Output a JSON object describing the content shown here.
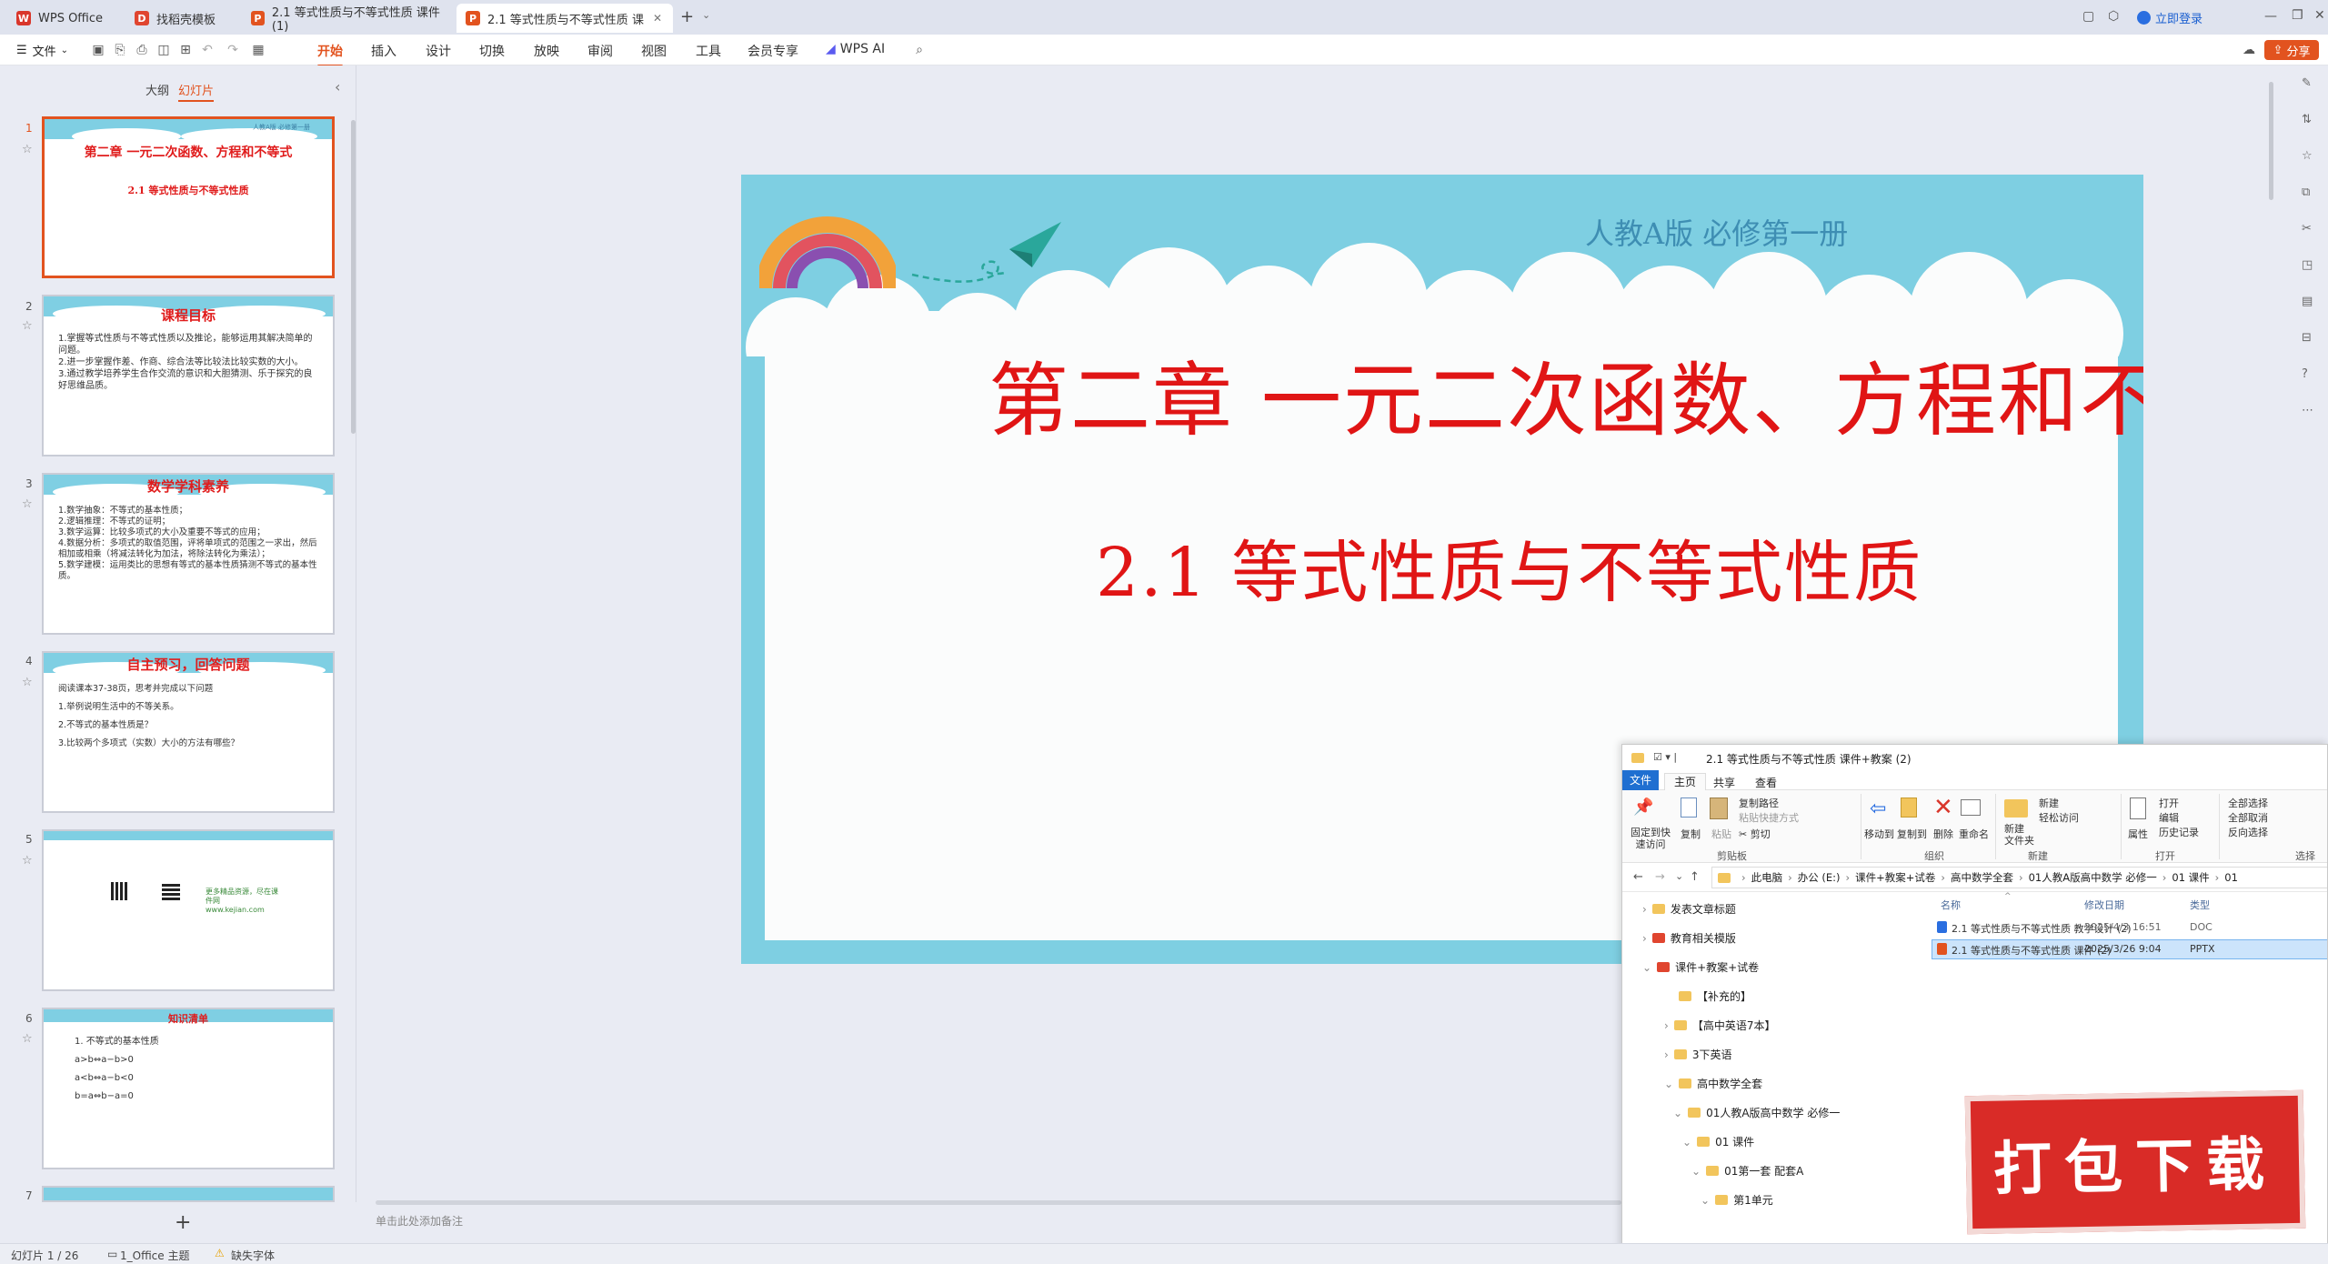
{
  "titlebar": {
    "tabs": [
      {
        "label": "WPS Office",
        "icon": "wps-logo-icon",
        "color": "#d9362b"
      },
      {
        "label": "找稻壳模板",
        "icon": "docer-icon",
        "color": "#e0452f"
      },
      {
        "label": "2.1 等式性质与不等式性质 课件 (1)",
        "icon": "ppt-icon",
        "color": "#e2531f"
      },
      {
        "label": "2.1 等式性质与不等式性质 课",
        "icon": "ppt-icon",
        "color": "#e2531f"
      }
    ],
    "login_label": "立即登录"
  },
  "menubar": {
    "file_label": "文件",
    "items": [
      "开始",
      "插入",
      "设计",
      "切换",
      "放映",
      "审阅",
      "视图",
      "工具",
      "会员专享",
      "WPS AI"
    ],
    "active": "开始",
    "share_label": "分享"
  },
  "leftpanel": {
    "tabs": [
      "大纲",
      "幻灯片"
    ],
    "active_tab": "幻灯片",
    "add_label": "+",
    "slides": [
      {
        "num": "1",
        "title": "第二章 一元二次函数、方程和不等式",
        "subtitle": "2.1 等式性质与不等式性质",
        "corner": "人教A版 必修第一册"
      },
      {
        "num": "2",
        "title": "课程目标",
        "body": "1.掌握等式性质与不等式性质以及推论，能够运用其解决简单的问题。\n2.进一步掌握作差、作商、综合法等比较法比较实数的大小。\n3.通过教学培养学生合作交流的意识和大胆猜测、乐于探究的良好思维品质。"
      },
      {
        "num": "3",
        "title": "数学学科素养",
        "body": "1.数学抽象：不等式的基本性质；\n2.逻辑推理：不等式的证明；\n3.数学运算：比较多项式的大小及重要不等式的应用；\n4.数据分析：多项式的取值范围，评将单项式的范围之一求出，然后相加或相乘（将减法转化为加法，将除法转化为乘法）；\n5.数学建模：运用类比的思想有等式的基本性质猜测不等式的基本性质。"
      },
      {
        "num": "4",
        "title": "自主预习，回答问题",
        "body": "阅读课本37-38页，思考并完成以下问题\n1.举例说明生活中的不等关系。\n2.不等式的基本性质是？\n3.比较两个多项式（实数）大小的方法有哪些？"
      },
      {
        "num": "5",
        "title": "",
        "body": "更多精品资源，尽在课件网\n www.kejian.com"
      },
      {
        "num": "6",
        "title": "知识清单",
        "body": "1. 不等式的基本性质\na>b⇔a−b>0\na<b⇔a−b<0\nb=a⇔b−a=0"
      },
      {
        "num": "7",
        "title": "",
        "body": ""
      }
    ]
  },
  "slide": {
    "edition": "人教A版 必修第一册",
    "chapter_title": "第二章  一元二次函数、方程和不等式",
    "section_title": "2.1 等式性质与不等式性质",
    "notes_placeholder": "单击此处添加备注"
  },
  "explorer": {
    "title": "2.1 等式性质与不等式性质 课件+教案 (2)",
    "ribbon_tabs": [
      "文件",
      "主页",
      "共享",
      "查看"
    ],
    "clipboard": {
      "pin": "固定到快速访问",
      "copy": "复制",
      "paste": "粘贴",
      "copy_path": "复制路径",
      "paste_shortcut": "粘贴快捷方式",
      "cut": "剪切",
      "group": "剪贴板"
    },
    "organize": {
      "move": "移动到",
      "copy_to": "复制到",
      "delete": "删除",
      "rename": "重命名",
      "group": "组织"
    },
    "new": {
      "new_folder": "新建\n文件夹",
      "new_item": "新建",
      "easy_access": "轻松访问",
      "group": "新建"
    },
    "open": {
      "props": "属性",
      "open": "打开",
      "edit": "编辑",
      "history": "历史记录",
      "group": "打开"
    },
    "select": {
      "all": "全部选择",
      "none": "全部取消",
      "invert": "反向选择",
      "group": "选择"
    },
    "breadcrumb": [
      "此电脑",
      "办公 (E:)",
      "课件+教案+试卷",
      "高中数学全套",
      "01人教A版高中数学 必修一",
      "01 课件",
      "01"
    ],
    "columns": [
      "名称",
      "修改日期",
      "类型"
    ],
    "files": [
      {
        "name": "2.1 等式性质与不等式性质 教学设计 (2)",
        "date": "2025/4/3 16:51",
        "type": "DOC"
      },
      {
        "name": "2.1 等式性质与不等式性质 课件 (2)",
        "date": "2025/3/26 9:04",
        "type": "PPTX"
      }
    ],
    "tree": [
      "发表文章标题",
      "教育相关模版",
      "课件+教案+试卷",
      "【补充的】",
      "【高中英语7本】",
      "3下英语",
      "高中数学全套",
      "01人教A版高中数学 必修一",
      "01 课件",
      "01第一套 配套A",
      "第1单元"
    ]
  },
  "statusbar": {
    "slide_count": "幻灯片 1 / 26",
    "theme": "1_Office 主题",
    "missing_font": "缺失字体"
  },
  "stamp": {
    "label": "打包下载"
  }
}
